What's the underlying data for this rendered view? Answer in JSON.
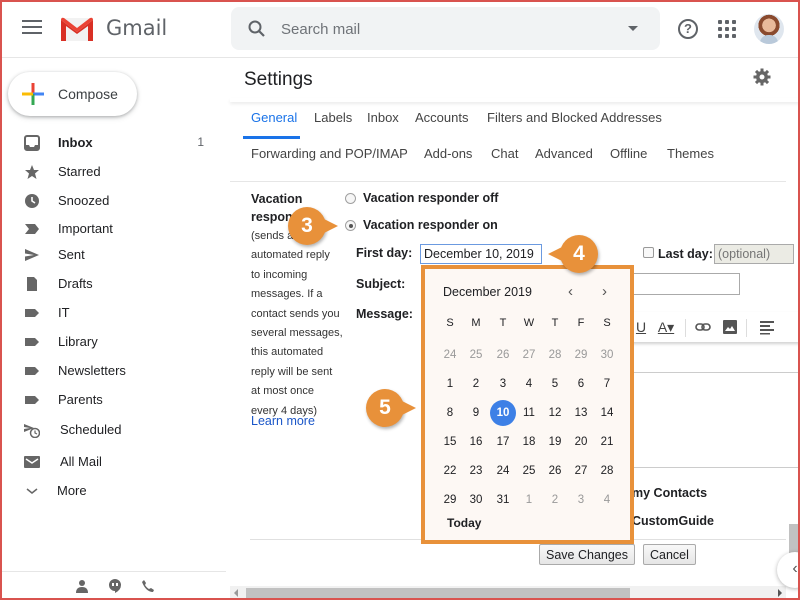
{
  "app": {
    "name": "Gmail",
    "brand_color": "#ea4335",
    "accent_color": "#1a73e8"
  },
  "header": {
    "search_placeholder": "Search mail",
    "icons": [
      "menu-icon",
      "gmail-logo",
      "search-icon",
      "search-options-icon",
      "help-icon",
      "apps-icon",
      "avatar"
    ]
  },
  "sidebar": {
    "compose_label": "Compose",
    "items": [
      {
        "label": "Inbox",
        "count": "1",
        "icon": "inbox-icon",
        "bold": true
      },
      {
        "label": "Starred",
        "count": "",
        "icon": "star-icon"
      },
      {
        "label": "Snoozed",
        "count": "",
        "icon": "clock-icon"
      },
      {
        "label": "Important",
        "count": "",
        "icon": "important-icon"
      },
      {
        "label": "Sent",
        "count": "",
        "icon": "send-icon"
      },
      {
        "label": "Drafts",
        "count": "",
        "icon": "draft-icon"
      },
      {
        "label": "IT",
        "count": "",
        "icon": "label-icon"
      },
      {
        "label": "Library",
        "count": "",
        "icon": "label-icon"
      },
      {
        "label": "Newsletters",
        "count": "",
        "icon": "label-icon"
      },
      {
        "label": "Parents",
        "count": "",
        "icon": "label-icon"
      },
      {
        "label": "Scheduled",
        "count": "",
        "icon": "scheduled-icon"
      },
      {
        "label": "All Mail",
        "count": "",
        "icon": "mail-icon"
      },
      {
        "label": "More",
        "count": "",
        "icon": "chevron-down-icon"
      }
    ],
    "bottom_icons": [
      "contacts-icon",
      "hangouts-icon",
      "phone-icon"
    ]
  },
  "settings": {
    "title": "Settings",
    "tabs_row1": [
      "General",
      "Labels",
      "Inbox",
      "Accounts",
      "Filters and Blocked Addresses"
    ],
    "tabs_row2": [
      "Forwarding and POP/IMAP",
      "Add-ons",
      "Chat",
      "Advanced",
      "Offline",
      "Themes"
    ],
    "active_tab": "General",
    "vacation": {
      "label_line1": "Vacation",
      "label_line2": "responder:",
      "description": [
        "(sends an",
        "automated reply",
        "to incoming",
        "messages. If a",
        "contact sends you",
        "several messages,",
        "this automated",
        "reply will be sent",
        "at most once",
        "every 4 days)"
      ],
      "learn_more": "Learn more",
      "option_off": "Vacation responder off",
      "option_on": "Vacation responder on",
      "selected": "on",
      "first_day_label": "First day:",
      "first_day_value": "December 10, 2019",
      "last_day_label": "Last day:",
      "last_day_placeholder": "(optional)",
      "last_day_checked": false,
      "subject_label": "Subject:",
      "message_label": "Message:",
      "contacts_option": "my Contacts",
      "org_option": "CustomGuide"
    },
    "save_label": "Save Changes",
    "cancel_label": "Cancel"
  },
  "calendar": {
    "month_label": "December 2019",
    "weekdays": [
      "S",
      "M",
      "T",
      "W",
      "T",
      "F",
      "S"
    ],
    "weeks": [
      [
        {
          "d": "24",
          "o": true
        },
        {
          "d": "25",
          "o": true
        },
        {
          "d": "26",
          "o": true
        },
        {
          "d": "27",
          "o": true
        },
        {
          "d": "28",
          "o": true
        },
        {
          "d": "29",
          "o": true
        },
        {
          "d": "30",
          "o": true
        }
      ],
      [
        {
          "d": "1"
        },
        {
          "d": "2"
        },
        {
          "d": "3"
        },
        {
          "d": "4"
        },
        {
          "d": "5"
        },
        {
          "d": "6"
        },
        {
          "d": "7"
        }
      ],
      [
        {
          "d": "8"
        },
        {
          "d": "9"
        },
        {
          "d": "10",
          "sel": true
        },
        {
          "d": "11"
        },
        {
          "d": "12"
        },
        {
          "d": "13"
        },
        {
          "d": "14"
        }
      ],
      [
        {
          "d": "15"
        },
        {
          "d": "16"
        },
        {
          "d": "17"
        },
        {
          "d": "18"
        },
        {
          "d": "19"
        },
        {
          "d": "20"
        },
        {
          "d": "21"
        }
      ],
      [
        {
          "d": "22"
        },
        {
          "d": "23"
        },
        {
          "d": "24"
        },
        {
          "d": "25"
        },
        {
          "d": "26"
        },
        {
          "d": "27"
        },
        {
          "d": "28"
        }
      ],
      [
        {
          "d": "29"
        },
        {
          "d": "30"
        },
        {
          "d": "31"
        },
        {
          "d": "1",
          "o": true
        },
        {
          "d": "2",
          "o": true
        },
        {
          "d": "3",
          "o": true
        },
        {
          "d": "4",
          "o": true
        }
      ]
    ],
    "selected_day": "10",
    "today_label": "Today",
    "selected_color": "#3d80e6"
  },
  "callouts": [
    "3",
    "4",
    "5"
  ],
  "callout_color": "#e8913a"
}
